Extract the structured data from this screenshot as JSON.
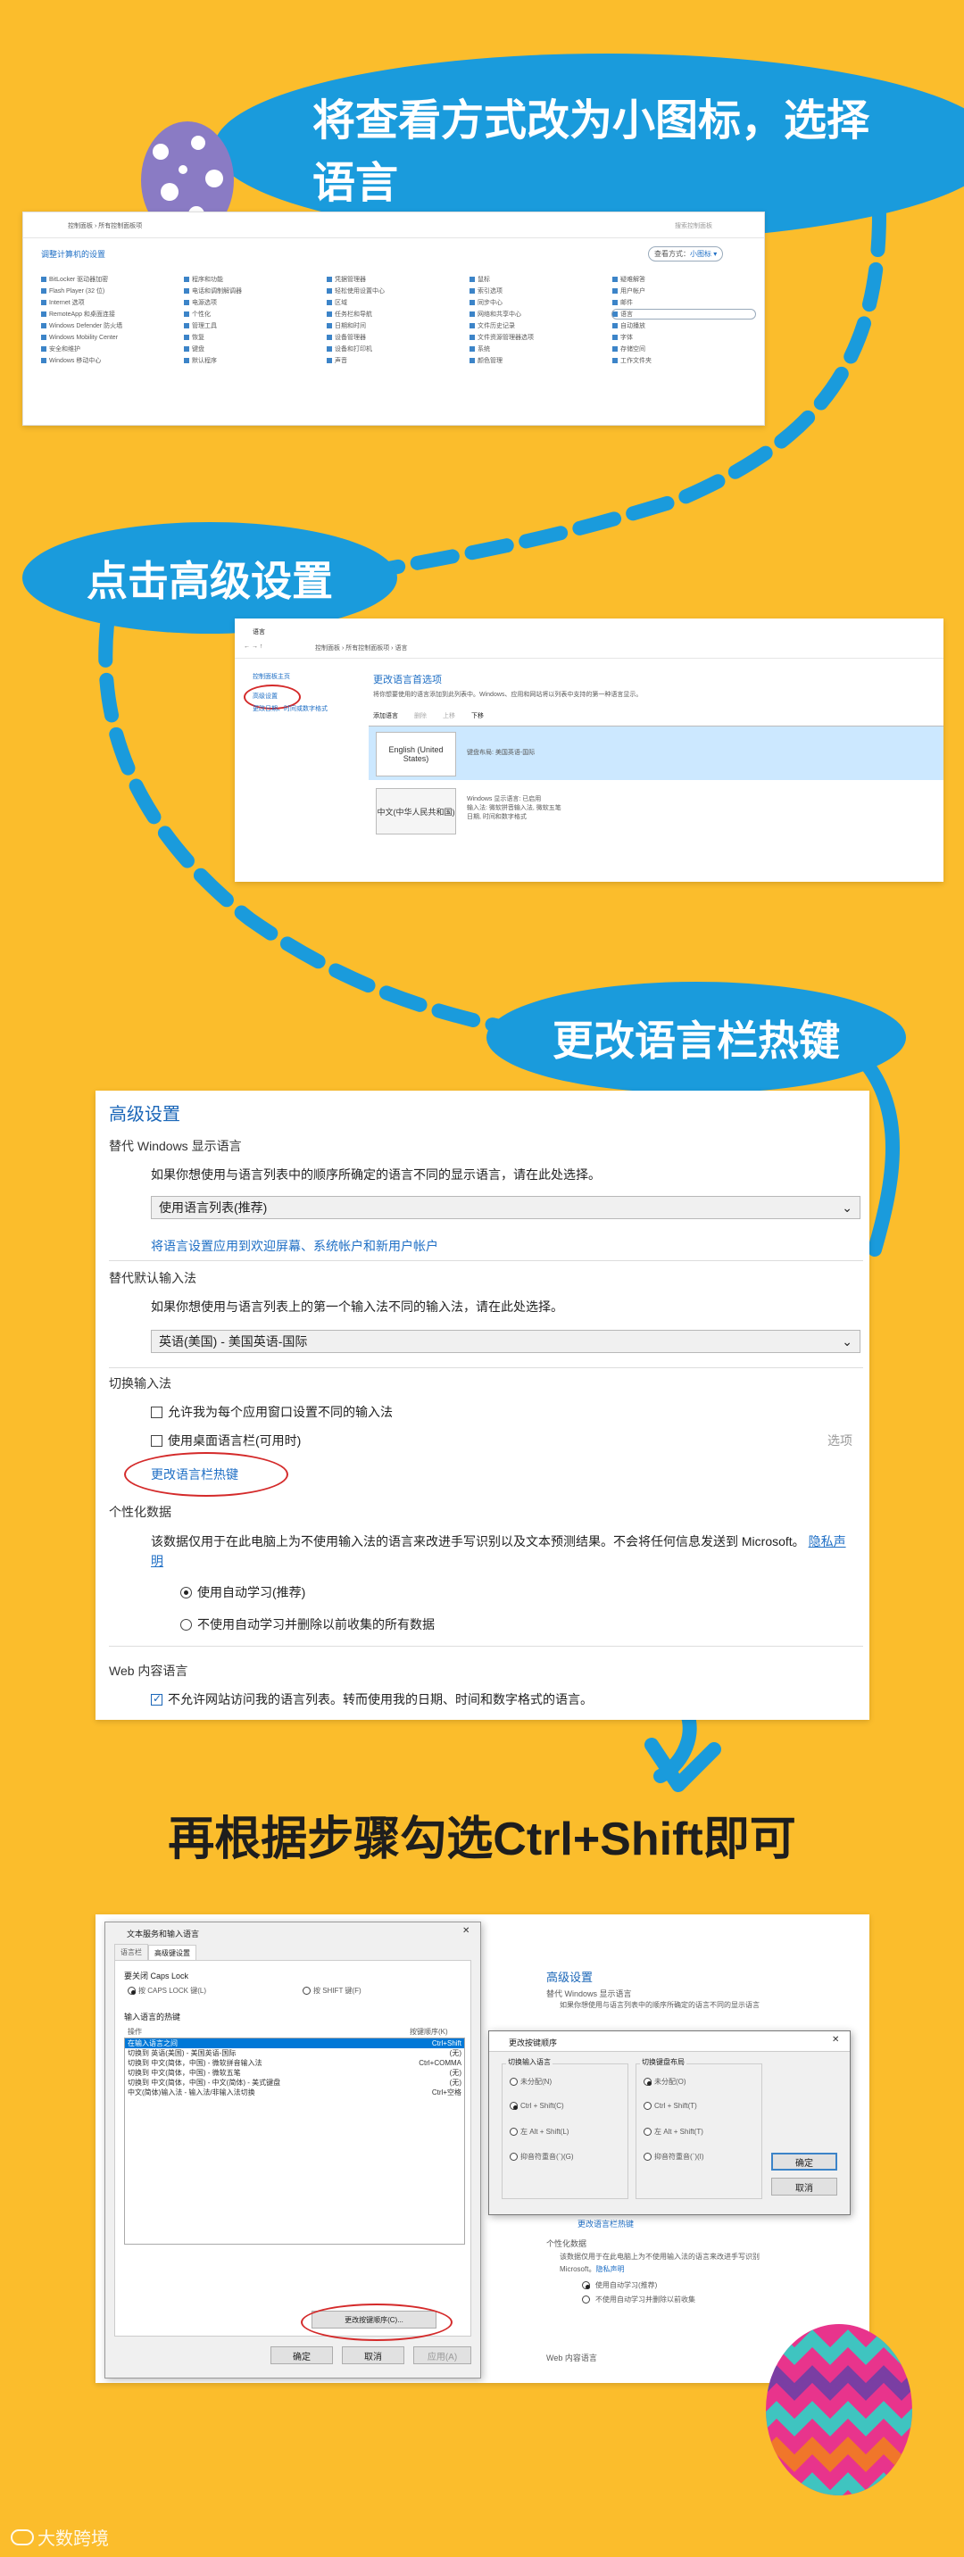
{
  "step1": {
    "title": "将查看方式改为小图标，选择语言",
    "cp": {
      "path": "控制面板 › 所有控制面板项",
      "search": "搜索控制面板",
      "heading": "调整计算机的设置",
      "view_label": "查看方式：",
      "view_value": "小图标 ▾",
      "items": [
        "BitLocker 驱动器加密",
        "Flash Player (32 位)",
        "Internet 选项",
        "RemoteApp 和桌面连接",
        "Windows Defender 防火墙",
        "Windows Mobility Center",
        "安全和维护",
        "Windows 移动中心",
        "程序和功能",
        "电话和调制解调器",
        "电源选项",
        "个性化",
        "管理工具",
        "恢复",
        "键盘",
        "默认程序",
        "凭据管理器",
        "轻松使用设置中心",
        "区域",
        "任务栏和导航",
        "日期和时间",
        "设备管理器",
        "设备和打印机",
        "声音",
        "鼠标",
        "索引选项",
        "同步中心",
        "网络和共享中心",
        "文件历史记录",
        "文件资源管理器选项",
        "系统",
        "颜色管理",
        "疑难解答",
        "用户帐户",
        "邮件",
        "语言",
        "自动播放",
        "字体",
        "存储空间",
        "工作文件夹"
      ],
      "selected_item": "语言"
    }
  },
  "step2": {
    "title": "点击高级设置",
    "lang": {
      "window_title": "语言",
      "path": "控制面板 › 所有控制面板项 › 语言",
      "side_home": "控制面板主页",
      "side_advanced": "高级设置",
      "side_datetime": "更改日期、时间或数字格式",
      "heading": "更改语言首选项",
      "desc": "将你想要使用的语言添加到此列表中。Windows、应用和网站将以列表中支持的第一种语言显示。",
      "toolbar": [
        "添加语言",
        "删除",
        "上移",
        "下移"
      ],
      "languages": [
        {
          "name": "English (United States)",
          "detail": "键盘布局: 美国英语-国际"
        },
        {
          "name": "中文(中华人民共和国)",
          "detail": "Windows 显示语言: 已启用\n输入法: 微软拼音输入法, 微软五笔\n日期, 时间和数字格式"
        }
      ]
    }
  },
  "step3": {
    "title": "更改语言栏热键",
    "adv": {
      "heading": "高级设置",
      "s1_title": "替代 Windows 显示语言",
      "s1_desc": "如果你想使用与语言列表中的顺序所确定的语言不同的显示语言，请在此处选择。",
      "s1_select": "使用语言列表(推荐)",
      "s1_link": "将语言设置应用到欢迎屏幕、系统帐户和新用户帐户",
      "s2_title": "替代默认输入法",
      "s2_desc": "如果你想使用与语言列表上的第一个输入法不同的输入法，请在此处选择。",
      "s2_select": "英语(美国) - 美国英语-国际",
      "s3_title": "切换输入法",
      "s3_opt1": "允许我为每个应用窗口设置不同的输入法",
      "s3_opt2": "使用桌面语言栏(可用时)",
      "s3_options": "选项",
      "s3_link": "更改语言栏热键",
      "s4_title": "个性化数据",
      "s4_desc": "该数据仅用于在此电脑上为不使用输入法的语言来改进手写识别以及文本预测结果。不会将任何信息发送到 Microsoft。",
      "s4_privacy": "隐私声明",
      "s4_radio1": "使用自动学习(推荐)",
      "s4_radio2": "不使用自动学习并删除以前收集的所有数据",
      "s5_title": "Web 内容语言",
      "s5_opt": "不允许网站访问我的语言列表。转而使用我的日期、时间和数字格式的语言。"
    }
  },
  "step4": {
    "title": "再根据步骤勾选Ctrl+Shift即可",
    "dialog": {
      "title": "文本服务和输入语言",
      "tabs": [
        "语言栏",
        "高级键设置"
      ],
      "capslock_title": "要关闭 Caps Lock",
      "capslock_opt1": "按 CAPS LOCK 键(L)",
      "capslock_opt2": "按 SHIFT 键(F)",
      "hotkey_title": "输入语言的热键",
      "col_action": "操作",
      "col_key": "按键顺序(K)",
      "rows": [
        {
          "action": "在输入语言之间",
          "key": "Ctrl+Shift"
        },
        {
          "action": "切换到 英语(美国) - 美国英语-国际",
          "key": "(无)"
        },
        {
          "action": "切换到 中文(简体，中国) - 微软拼音输入法",
          "key": "Ctrl+COMMA"
        },
        {
          "action": "切换到 中文(简体，中国) - 微软五笔",
          "key": "(无)"
        },
        {
          "action": "切换到 中文(简体，中国) - 中文(简体) - 美式键盘",
          "key": "(无)"
        },
        {
          "action": "中文(简体)输入法 - 输入法/非输入法切换",
          "key": "Ctrl+空格"
        }
      ],
      "change_btn": "更改按键顺序(C)...",
      "ok": "确定",
      "cancel": "取消",
      "apply": "应用(A)"
    },
    "popup": {
      "title": "更改按键顺序",
      "col1_title": "切换输入语言",
      "col1_opts": [
        "未分配(N)",
        "Ctrl + Shift(C)",
        "左 Alt + Shift(L)",
        "抑音符重音(`)(G)"
      ],
      "col1_selected": 1,
      "col2_title": "切换键盘布局",
      "col2_opts": [
        "未分配(O)",
        "Ctrl + Shift(T)",
        "左 Alt + Shift(T)",
        "抑音符重音(`)(I)"
      ],
      "col2_selected": 0,
      "ok": "确定",
      "cancel": "取消"
    },
    "bg": {
      "heading": "高级设置",
      "line1": "替代 Windows 显示语言",
      "line2": "如果你想使用与语言列表中的顺序所确定的语言不同的显示语言",
      "link": "更改语言栏热键",
      "pers": "个性化数据",
      "pers_desc": "该数据仅用于在此电脑上为不使用输入法的语言来改进手写识别",
      "ms": "Microsoft。",
      "privacy": "隐私声明",
      "r1": "使用自动学习(推荐)",
      "r2": "不使用自动学习并删除以前收集",
      "web": "Web 内容语言"
    }
  },
  "watermark": "大数跨境",
  "colors": {
    "background": "#fbbd2c",
    "bubble": "#1a9bdc",
    "link": "#1f6fc5",
    "circle": "#d42a2a"
  }
}
